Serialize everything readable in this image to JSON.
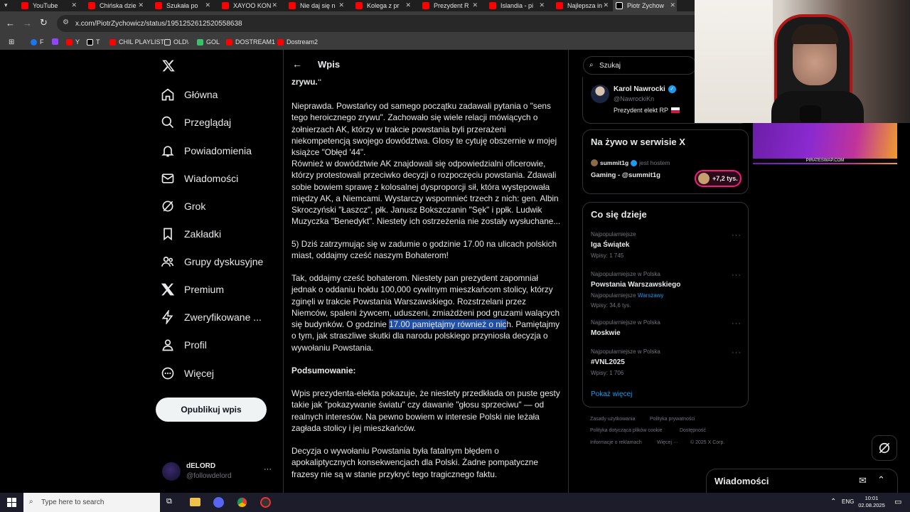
{
  "browser": {
    "tabs": [
      {
        "label": "YouTube"
      },
      {
        "label": "Chińska dzie"
      },
      {
        "label": "Szukała po"
      },
      {
        "label": "XAYOO KON"
      },
      {
        "label": "Nie daj się n"
      },
      {
        "label": "Kolega z pr"
      },
      {
        "label": "Prezydent R"
      },
      {
        "label": "Islandia - pi"
      },
      {
        "label": "Najlepsza in"
      },
      {
        "label": "Piotr Zychow"
      }
    ],
    "url": "x.com/PiotrZychowicz/status/1951252612520558638",
    "bookmarks": [
      {
        "label": "F",
        "color": "#1877f2"
      },
      {
        "label": "",
        "color": "#9146ff"
      },
      {
        "label": "Y",
        "color": "#ff0000"
      },
      {
        "label": "T",
        "color": "#ffffff"
      },
      {
        "label": "CHIL PLAYLIST",
        "color": "#ff0000"
      },
      {
        "label": "OLD\\",
        "color": "#e3e3e3"
      },
      {
        "label": "GOL",
        "color": "#3ac06b"
      },
      {
        "label": "DOSTREAM1",
        "color": "#ff0000"
      },
      {
        "label": "Dostream2",
        "color": "#ff0000"
      }
    ]
  },
  "nav": {
    "items": [
      {
        "label": "Główna",
        "icon": "home-icon"
      },
      {
        "label": "Przeglądaj",
        "icon": "search-icon"
      },
      {
        "label": "Powiadomienia",
        "icon": "bell-icon"
      },
      {
        "label": "Wiadomości",
        "icon": "mail-icon"
      },
      {
        "label": "Grok",
        "icon": "grok-icon"
      },
      {
        "label": "Zakładki",
        "icon": "bookmark-icon"
      },
      {
        "label": "Grupy dyskusyjne",
        "icon": "people-icon"
      },
      {
        "label": "Premium",
        "icon": "x-icon"
      },
      {
        "label": "Zweryfikowane ...",
        "icon": "lightning-icon"
      },
      {
        "label": "Profil",
        "icon": "person-icon"
      },
      {
        "label": "Więcej",
        "icon": "more-circle-icon"
      }
    ],
    "post_button": "Opublikuj wpis",
    "account": {
      "name": "dELORD",
      "handle": "@followdelord",
      "more": "···"
    }
  },
  "post": {
    "header_title": "Wpis",
    "top_fragment": "zrywu.\"",
    "p1": "Nieprawda. Powstańcy od samego początku zadawali pytania o \"sens tego heroicznego zrywu\". Zachowało się wiele relacji mówiących o żołnierzach AK, którzy w trakcie powstania byli przerażeni niekompetencją swojego dowództwa. Glosy te cytuję obszernie w mojej książce \"Obłęd '44\".",
    "p2": "Również w dowództwie AK znajdowali się odpowiedzialni oficerowie, którzy protestowali przeciwko decyzji o rozpoczęciu powstania. Zdawali sobie bowiem sprawę z kolosalnej dysproporcji sił, która występowała między  AK, a Niemcami. Wystarczy wspomnieć trzech z nich: gen. Albin Skroczyński \"Łaszcz\", płk. Janusz Bokszczanin \"Sęk\" i  ppłk. Ludwik Muzyczka \"Benedykt\". Niestety ich ostrzeżenia nie zostały wysłuchane...",
    "p3": "5) Dziś zatrzymując się w zadumie o godzinie 17.00 na ulicach polskich miast, oddajmy cześć naszym Bohaterom!",
    "p4_before": "Tak, oddajmy cześć bohaterom. Niestety pan prezydent zapomniał jednak o oddaniu hołdu 100,000 cywilnym mieszkańcom stolicy, którzy zginęli w trakcie Powstania Warszawskiego. Rozstrzelani przez Niemców, spaleni żywcem, uduszeni, zmiażdżeni pod gruzami walących się budynków. O godzinie ",
    "p4_highlight": "17.00 pamiętajmy również o nic",
    "p4_after": "h. Pamiętajmy o tym, jak straszliwe skutki dla narodu polskiego przyniosła decyzja o wywołaniu Powstania.",
    "summary_title": "Podsumowanie:",
    "p5": "Wpis prezydenta-elekta pokazuje, że niestety przedkłada on puste gesty takie jak \"pokazywanie światu\" czy dawanie \"głosu sprzeciwu\" — od realnych interesów. Na pewno bowiem w interesie Polski nie leżała zagłada stolicy i jej mieszkańców.",
    "p6": "Decyzja o wywołaniu Powstania była fatalnym błędem o apokaliptycznych konsekwencjach dla Polski. Żadne pompatyczne frazesy nie są w stanie przykryć tego tragicznego faktu."
  },
  "right": {
    "search_placeholder": "Szukaj",
    "profile": {
      "name": "Karol Nawrocki",
      "handle": "@NawrockiKn",
      "bio": "Prezydent elekt RP"
    },
    "live": {
      "title": "Na żywo w serwisie X",
      "host_name": "summit1g",
      "host_suffix": "jest hostem",
      "show": "Gaming - @summit1g",
      "listeners": "+7,2 tys."
    },
    "trends": {
      "title": "Co się dzieje",
      "items": [
        {
          "category": "Najpopularniejsze",
          "name": "Iga Świątek",
          "count": "Wpisy: 1 745",
          "sub": ""
        },
        {
          "category": "Najpopularniejsze w Polska",
          "name": "Powstania Warszawskiego",
          "sub": "Najpopularniejsze",
          "sub_link": "Warszawy",
          "count": "Wpisy: 34,6 tys."
        },
        {
          "category": "Najpopularniejsze w Polska",
          "name": "Moskwie",
          "count": "",
          "sub": ""
        },
        {
          "category": "Najpopularniejsze w Polska",
          "name": "#VNL2025",
          "count": "Wpisy: 1 706",
          "sub": ""
        }
      ],
      "show_more": "Pokaż więcej"
    },
    "footer": {
      "line1": [
        "Zasady użytkowania",
        "Polityka prywatności"
      ],
      "line2": [
        "Polityka dotycząca plików cookie",
        "Dostępność"
      ],
      "line3": [
        "Informacje o reklamach",
        "Więcej ···",
        "© 2025 X Corp."
      ]
    }
  },
  "messages_drawer": {
    "title": "Wiadomości"
  },
  "promo": {
    "text": "PIRATESWAP.COM"
  },
  "taskbar": {
    "search_placeholder": "Type here to search",
    "lang": "ENG",
    "time": "10:01",
    "date": "02.08.2025"
  },
  "colors": {
    "accent": "#1d9bf0",
    "highlight": "#1f4fa8",
    "border": "#2f3336",
    "listeners": "#f91880"
  }
}
